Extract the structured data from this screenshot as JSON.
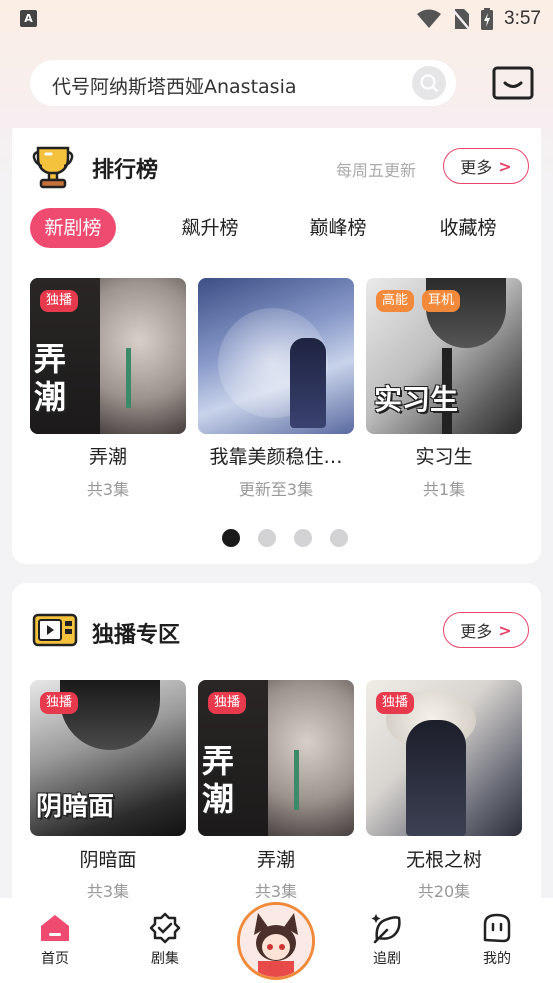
{
  "status_bar": {
    "time": "3:57",
    "left_icon": "A"
  },
  "search": {
    "text": "代号阿纳斯塔西娅Anastasia",
    "icon": "search-icon"
  },
  "ranking": {
    "title": "排行榜",
    "subtitle": "每周五更新",
    "more_label": "更多",
    "tabs": [
      "新剧榜",
      "飙升榜",
      "巅峰榜",
      "收藏榜"
    ],
    "active_tab": "新剧榜",
    "items": [
      {
        "title": "弄潮",
        "sub": "共3集",
        "badges": [
          "独播"
        ],
        "cover_text": "弄\n潮"
      },
      {
        "title": "我靠美颜稳住…",
        "sub": "更新至3集",
        "badges": [],
        "cover_text": ""
      },
      {
        "title": "实习生",
        "sub": "共1集",
        "badges": [
          "高能",
          "耳机"
        ],
        "cover_text": "实习生"
      }
    ],
    "page_dots": 4,
    "active_dot": 0
  },
  "exclusive": {
    "title": "独播专区",
    "more_label": "更多",
    "items": [
      {
        "title": "阴暗面",
        "sub": "共3集",
        "badge": "独播",
        "cover_text": "阴暗面"
      },
      {
        "title": "弄潮",
        "sub": "共3集",
        "badge": "独播",
        "cover_text": "弄\n潮"
      },
      {
        "title": "无根之树",
        "sub": "共20集",
        "badge": "独播",
        "cover_text": ""
      }
    ]
  },
  "nav": {
    "items": [
      {
        "label": "首页",
        "icon": "home-icon"
      },
      {
        "label": "剧集",
        "icon": "drama-icon"
      },
      {
        "label": "追剧",
        "icon": "follow-icon"
      },
      {
        "label": "我的",
        "icon": "profile-icon"
      }
    ]
  },
  "colors": {
    "accent": "#ef4b70",
    "badge_red": "#e73a4d",
    "badge_orange": "#f3893a"
  }
}
